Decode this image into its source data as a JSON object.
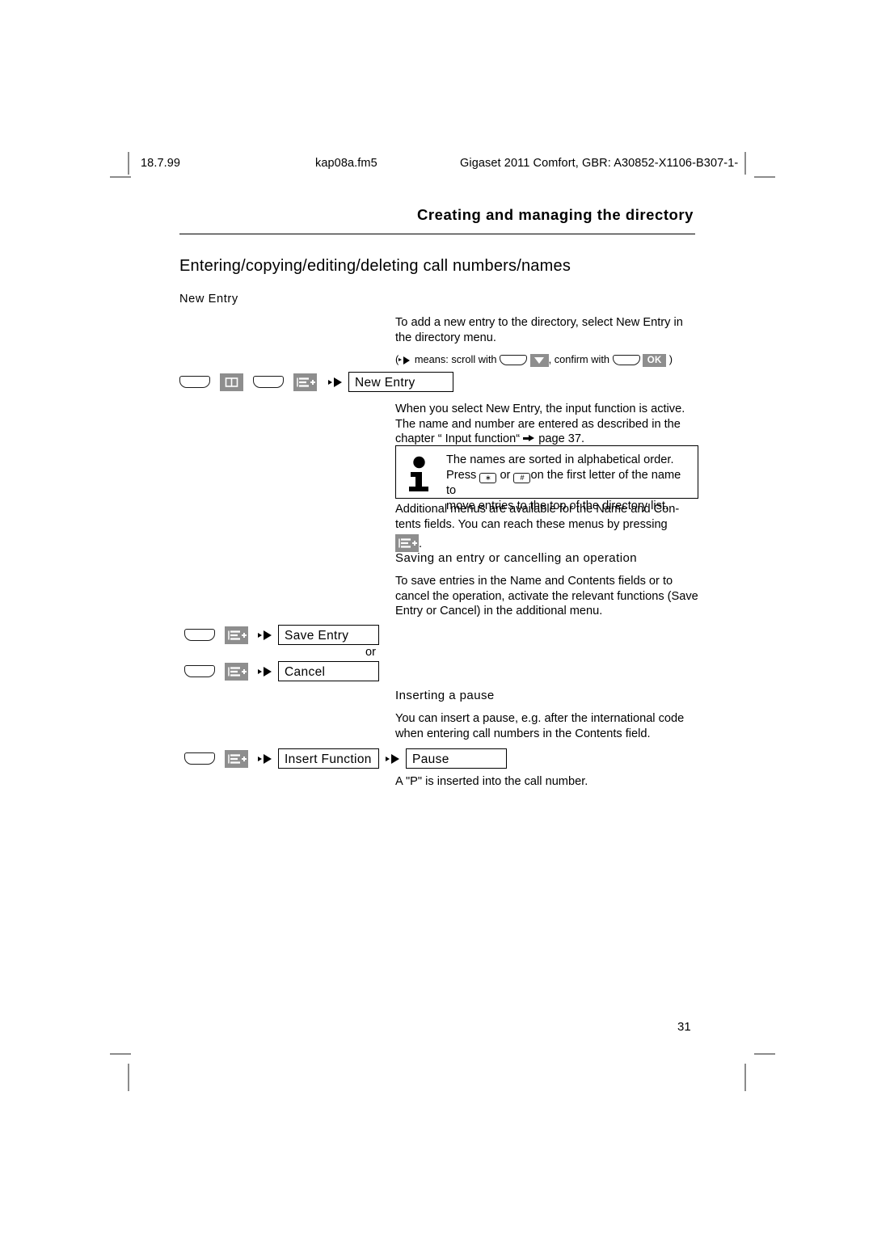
{
  "running_head": {
    "date": "18.7.99",
    "file": "kap08a.fm5",
    "document": "Gigaset 2011 Comfort, GBR: A30852-X1106-B307-1-"
  },
  "chapter_title": "Creating and managing the directory",
  "section_heading": "Entering/copying/editing/deleting call numbers/names",
  "new_entry": {
    "label": "New Entry",
    "intro": "To add a new entry to the directory, select New Entry in the directory menu.",
    "legend_open": "(",
    "legend_means": "means: scroll with",
    "legend_confirm": ", confirm with",
    "legend_close": ")",
    "key_ok": "OK",
    "menu_box": "New Entry",
    "body": "When you select New Entry, the input function is active. The name and number are entered as described in the chapter “ Input function“",
    "body_page_ref": "page 37."
  },
  "note": {
    "line1": "The names are sorted in alphabetical order.",
    "press": "Press",
    "star_key": "∗",
    "or": "or",
    "hash_key": "#",
    "line2_tail": "on the first letter of the name to",
    "line3": "move entries to the top of the directory list."
  },
  "additional_menus": {
    "text_a": "Additional menus are available for the Name and Con-",
    "text_b": "tents fields. You can reach these menus by pressing",
    "text_c": "."
  },
  "saving": {
    "heading": "Saving an entry or cancelling an operation",
    "body": "To save entries in the Name and Contents fields or to cancel the operation, activate the relevant functions (Save Entry or Cancel) in the additional menu.",
    "save_box": "Save Entry",
    "or_label": "or",
    "cancel_box": "Cancel"
  },
  "pause": {
    "heading": "Inserting a pause",
    "body": "You can insert a pause, e.g. after the international code when entering call numbers in the Contents field.",
    "insert_box": "Insert Function",
    "pause_box": "Pause",
    "result": "A \"P\" is inserted into the call number."
  },
  "page_number": "31",
  "icons": {
    "softkey": "softkey-blank",
    "directory": "book-directory-icon",
    "menu": "menu-plus-icon",
    "scroll_down": "chevron-down-icon",
    "ok": "ok-key-icon",
    "info": "info-i-icon"
  }
}
